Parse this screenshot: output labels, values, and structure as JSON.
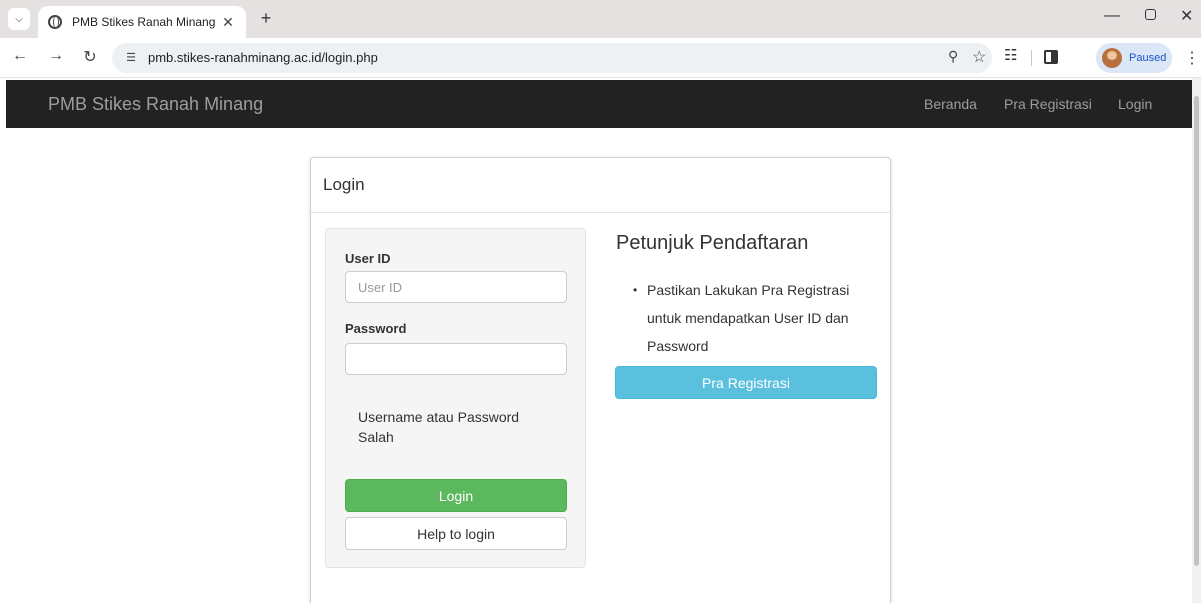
{
  "browser": {
    "tab_title": "PMB Stikes Ranah Minang",
    "url": "pmb.stikes-ranahminang.ac.id/login.php",
    "profile_status": "Paused",
    "icons": {
      "tab_search": "chevron-down-icon",
      "tab_close": "close-icon",
      "new_tab": "plus-icon",
      "back": "arrow-left-icon",
      "forward": "arrow-right-icon",
      "reload": "reload-icon",
      "site_info": "tune-icon",
      "zoom": "zoom-icon",
      "bookmark": "star-icon",
      "extensions": "puzzle-icon",
      "side_panel": "side-panel-icon",
      "menu": "kebab-menu-icon"
    }
  },
  "navbar": {
    "brand": "PMB Stikes Ranah Minang",
    "links": [
      "Beranda",
      "Pra Registrasi",
      "Login"
    ],
    "background": "#222222",
    "text_color": "#9d9d9d"
  },
  "panel": {
    "title": "Login",
    "form": {
      "userid_label": "User ID",
      "userid_placeholder": "User ID",
      "userid_value": "",
      "password_label": "Password",
      "password_value": "",
      "error_message": "Username atau Password Salah",
      "login_button": "Login",
      "help_button": "Help to login"
    },
    "info": {
      "title": "Petunjuk Pendaftaran",
      "items": [
        "Pastikan Lakukan Pra Registrasi untuk mendapatkan User ID dan Password"
      ],
      "button": "Pra Registrasi"
    }
  },
  "colors": {
    "login_button": "#5cb85c",
    "pra_registrasi_button": "#5bc0de"
  }
}
